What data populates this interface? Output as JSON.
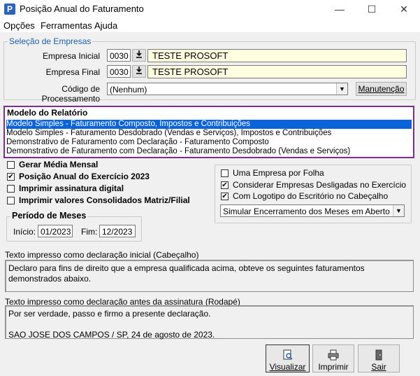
{
  "window": {
    "title": "Posição Anual do Faturamento",
    "icon_letter": "P",
    "minimize": "—",
    "maximize": "☐",
    "close": "✕"
  },
  "menu": [
    "Opções",
    "Ferramentas",
    "Ajuda"
  ],
  "empresas": {
    "legend": "Seleção de Empresas",
    "inicial_label": "Empresa Inicial",
    "inicial_code": "0030",
    "inicial_name": "TESTE PROSOFT",
    "final_label": "Empresa Final",
    "final_code": "0030",
    "final_name": "TESTE PROSOFT",
    "processamento_label": "Código de Processamento",
    "processamento_value": "(Nenhum)",
    "manutencao_button": "Manutenção"
  },
  "modelo": {
    "legend": "Modelo do Relatório",
    "items": [
      "Modelo Simples - Faturamento Composto, Impostos e Contribuições",
      "Modelo Simples - Faturamento Desdobrado (Vendas e Serviços), Impostos e Contribuições",
      "Demonstrativo de Faturamento com Declaração - Faturamento Composto",
      "Demonstrativo de Faturamento com Declaração - Faturamento Desdobrado (Vendas e Serviços)"
    ],
    "selected_index": 0
  },
  "options_left": [
    {
      "label": "Gerar Média Mensal",
      "checked": false
    },
    {
      "label": "Posição Anual do Exercício 2023",
      "checked": true
    },
    {
      "label": "Imprimir assinatura digital",
      "checked": false
    },
    {
      "label": "Imprimir valores Consolidados Matriz/Filial",
      "checked": false
    }
  ],
  "options_right": [
    {
      "label": "Uma Empresa por Folha",
      "checked": false
    },
    {
      "label": "Considerar Empresas Desligadas no Exercício",
      "checked": true
    },
    {
      "label": "Com Logotipo do Escritório no Cabeçalho",
      "checked": true
    }
  ],
  "check_mark": "✔",
  "simular_value": "Simular Encerramento dos Meses em Aberto",
  "periodo": {
    "legend": "Período de Meses",
    "inicio_label": "Início:",
    "inicio_value": "01/2023",
    "fim_label": "Fim:",
    "fim_value": "12/2023"
  },
  "cabecalho": {
    "label": "Texto impresso como declaração inicial (Cabeçalho)",
    "text": "Declaro para fins de direito que a empresa qualificada acima, obteve os seguintes faturamentos demonstrados abaixo."
  },
  "rodape": {
    "label": "Texto impresso como declaração antes da assinatura (Rodapé)",
    "text": "Por ser verdade, passo e firmo a presente declaração.\n\nSAO JOSE DOS CAMPOS / SP, 24 de agosto de 2023."
  },
  "buttons": {
    "visualizar": "Visualizar",
    "imprimir": "Imprimir",
    "sair": "Sair"
  },
  "colors": {
    "selection": "#0a64d8",
    "list_border": "#7b2c8c",
    "yellow_field": "#fefee0",
    "legend_blue": "#1f5fa8"
  }
}
